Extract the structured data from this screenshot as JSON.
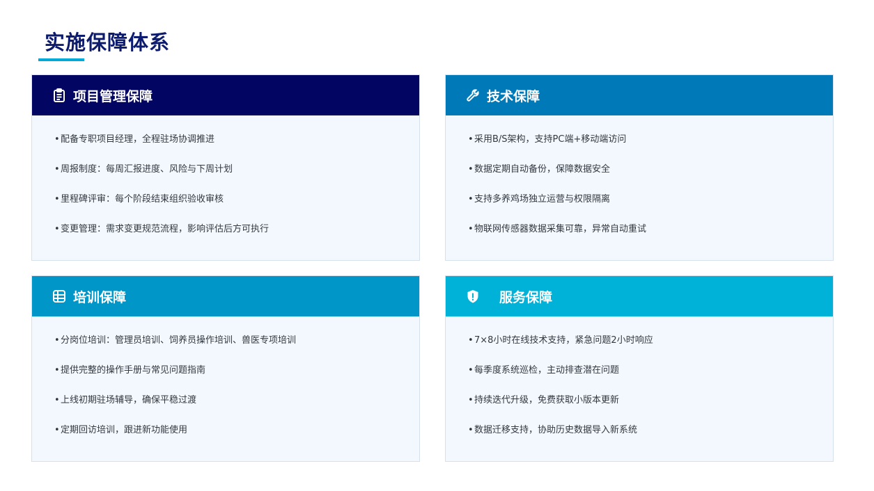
{
  "page": {
    "title": "实施保障体系"
  },
  "colors": {
    "title": "#0d1b6e",
    "accent_underline": "#00a9d8",
    "pm_header": "#020561",
    "tech_header": "#0079b8",
    "training_header": "#0096c7",
    "service_header": "#00b2d8",
    "card_background": "#f3f8fe"
  },
  "cards": [
    {
      "title": "项目管理保障",
      "icon": "clipboard-icon",
      "items": [
        "配备专职项目经理，全程驻场协调推进",
        "周报制度：每周汇报进度、风险与下周计划",
        "里程碑评审：每个阶段结束组织验收审核",
        "变更管理：需求变更规范流程，影响评估后方可执行"
      ]
    },
    {
      "title": "技术保障",
      "icon": "wrench-icon",
      "items": [
        "采用B/S架构，支持PC端+移动端访问",
        "数据定期自动备份，保障数据安全",
        "支持多养鸡场独立运营与权限隔离",
        "物联网传感器数据采集可靠，异常自动重试"
      ]
    },
    {
      "title": "培训保障",
      "icon": "training-icon",
      "items": [
        "分岗位培训：管理员培训、饲养员操作培训、兽医专项培训",
        "提供完整的操作手册与常见问题指南",
        "上线初期驻场辅导，确保平稳过渡",
        "定期回访培训，跟进新功能使用"
      ]
    },
    {
      "title": "服务保障",
      "icon": "shield-icon",
      "items": [
        "7×8小时在线技术支持，紧急问题2小时响应",
        "每季度系统巡检，主动排查潜在问题",
        "持续迭代升级，免费获取小版本更新",
        "数据迁移支持，协助历史数据导入新系统"
      ]
    }
  ]
}
